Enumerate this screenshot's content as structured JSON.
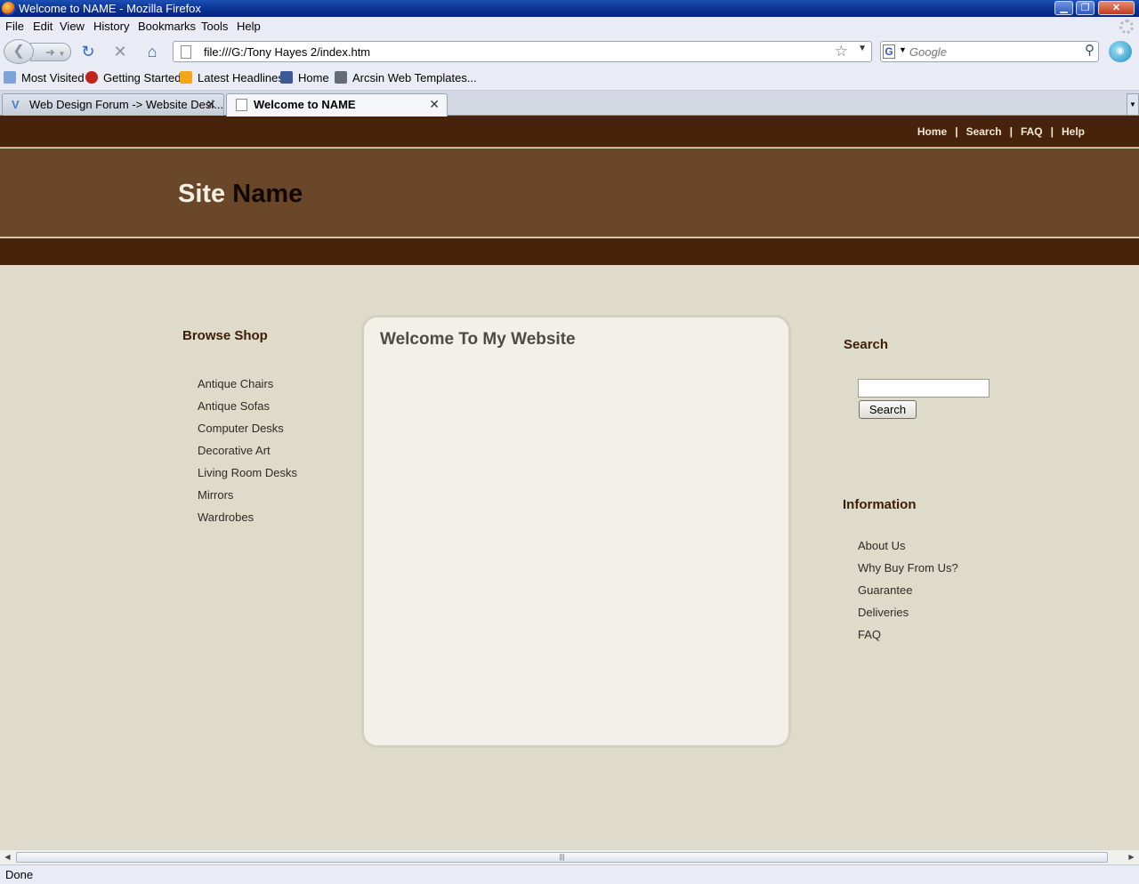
{
  "window": {
    "title": "Welcome to NAME - Mozilla Firefox",
    "min_label": "▁",
    "max_label": "❐",
    "close_label": "✕"
  },
  "menu": [
    "File",
    "Edit",
    "View",
    "History",
    "Bookmarks",
    "Tools",
    "Help"
  ],
  "navigation": {
    "url": "file:///G:/Tony Hayes 2/index.htm",
    "search_placeholder": "Google"
  },
  "bookmarks": [
    "Most Visited",
    "Getting Started",
    "Latest Headlines",
    "Home",
    "Arcsin Web Templates..."
  ],
  "tabs": [
    {
      "title": "Web Design Forum -> Website Desi...",
      "active": false
    },
    {
      "title": "Welcome to NAME",
      "active": true
    }
  ],
  "site": {
    "top_nav": [
      "Home",
      "Search",
      "FAQ",
      "Help"
    ],
    "nav_separator": "|",
    "title_part1": "Site",
    "title_part2": "Name",
    "browse_heading": "Browse Shop",
    "browse_links": [
      "Antique Chairs",
      "Antique Sofas",
      "Computer Desks",
      "Decorative Art",
      "Living Room Desks",
      "Mirrors",
      "Wardrobes"
    ],
    "welcome_heading": "Welcome To My Website",
    "search_heading": "Search",
    "search_button": "Search",
    "info_heading": "Information",
    "info_links": [
      "About Us",
      "Why Buy From Us?",
      "Guarantee",
      "Deliveries",
      "FAQ"
    ]
  },
  "status": {
    "text": "Done"
  },
  "colors": {
    "dark_brown": "#46230a",
    "header_brown": "#6b4729",
    "page_background": "#dedbca",
    "content_box": "#f2f0e8"
  },
  "icons": [
    "firefox-icon",
    "back-icon",
    "forward-icon",
    "reload-icon",
    "stop-icon",
    "home-icon",
    "page-icon",
    "star-icon",
    "google-icon",
    "magnifier-icon",
    "rss-icon",
    "facebook-icon"
  ]
}
